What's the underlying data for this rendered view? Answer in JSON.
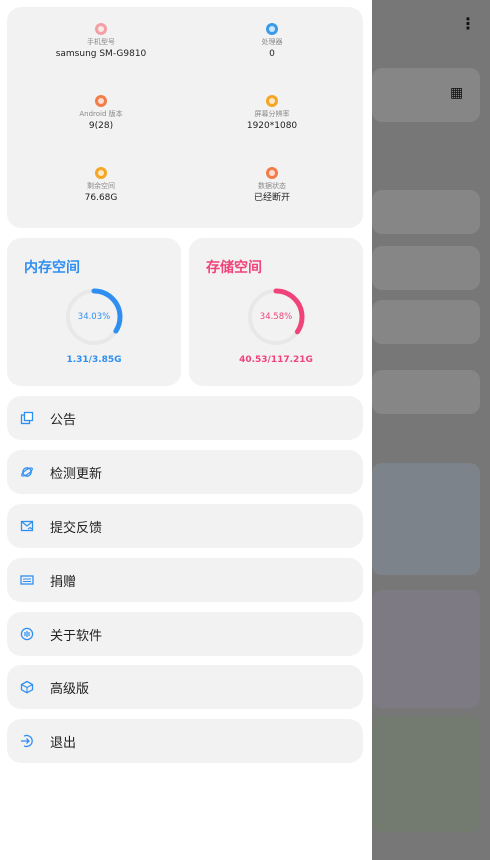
{
  "device_info": {
    "model": {
      "label": "手机型号",
      "value": "samsung SM-G9810",
      "icon": "phone-icon",
      "color": "#f3a0a4"
    },
    "processor": {
      "label": "处理器",
      "value": "0",
      "icon": "cpu-icon",
      "color": "#3b9be8"
    },
    "android": {
      "label": "Android 版本",
      "value": "9(28)",
      "icon": "android-icon",
      "color": "#f27c4a"
    },
    "resolution": {
      "label": "屏幕分辨率",
      "value": "1920*1080",
      "icon": "screen-icon",
      "color": "#f5a623"
    },
    "storage_left": {
      "label": "剩余空间",
      "value": "76.68G",
      "icon": "disk-icon",
      "color": "#f5a623"
    },
    "data_state": {
      "label": "数据状态",
      "value": "已经断开",
      "icon": "network-icon",
      "color": "#f27c4a"
    }
  },
  "memory": {
    "title": "内存空间",
    "percent_text": "34.03%",
    "fraction": 0.3403,
    "usage": "1.31/3.85G",
    "color": "#2f8ff0"
  },
  "storage": {
    "title": "存储空间",
    "percent_text": "34.58%",
    "fraction": 0.3458,
    "usage": "40.53/117.21G",
    "color": "#f0437a"
  },
  "menu": [
    {
      "label": "公告",
      "icon": "announcement-icon"
    },
    {
      "label": "检测更新",
      "icon": "update-icon"
    },
    {
      "label": "提交反馈",
      "icon": "feedback-icon"
    },
    {
      "label": "捐赠",
      "icon": "donate-icon"
    },
    {
      "label": "关于软件",
      "icon": "about-icon"
    },
    {
      "label": "高级版",
      "icon": "premium-icon"
    },
    {
      "label": "退出",
      "icon": "exit-icon"
    }
  ],
  "accent_color": "#2f8ff0"
}
